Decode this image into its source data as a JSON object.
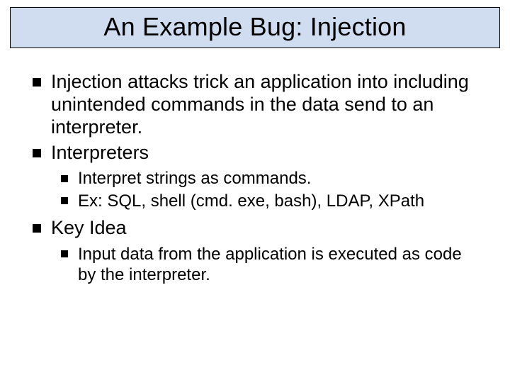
{
  "title": "An Example Bug: Injection",
  "bullets": [
    {
      "text": "Injection attacks trick an application into including unintended commands in the data send to an interpreter."
    },
    {
      "text": "Interpreters",
      "children": [
        {
          "text": "Interpret strings as commands."
        },
        {
          "text": "Ex: SQL, shell (cmd. exe, bash), LDAP, XPath"
        }
      ]
    },
    {
      "text": "Key Idea",
      "children": [
        {
          "text": "Input data from the application is executed as code by the interpreter."
        }
      ]
    }
  ]
}
